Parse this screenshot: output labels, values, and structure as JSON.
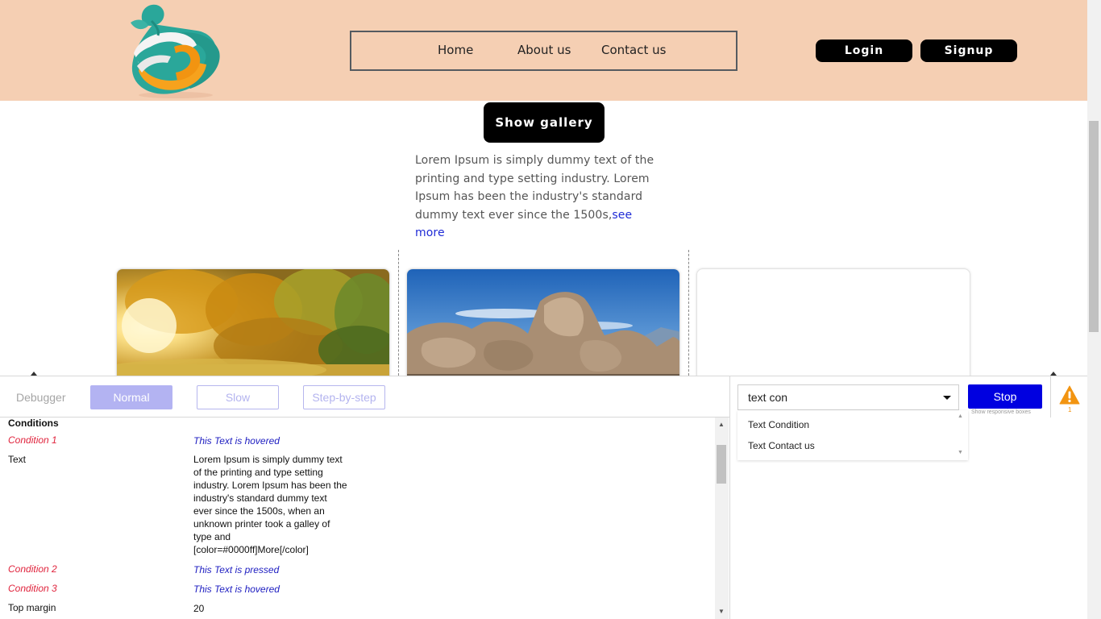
{
  "header": {
    "nav": {
      "home": "Home",
      "about": "About us",
      "contact": "Contact us"
    },
    "login": "Login",
    "signup": "Signup"
  },
  "main": {
    "gallery_button": "Show gallery",
    "intro_text": "Lorem Ipsum is simply dummy text of the printing and type setting industry. Lorem Ipsum has been the industry's standard dummy text ever since the 1500s,",
    "see_more": "see more"
  },
  "debugger": {
    "title": "Debugger",
    "modes": {
      "normal": "Normal",
      "slow": "Slow",
      "step": "Step-by-step"
    },
    "conditions_header": "Conditions",
    "rows": [
      {
        "label": "Condition 1",
        "value": "This Text is hovered"
      },
      {
        "label": "Text",
        "value": "Lorem Ipsum is simply dummy text of the printing and type setting industry. Lorem Ipsum has been the industry's standard dummy text ever since the 1500s, when an unknown printer took a galley of type and [color=#0000ff]More[/color]"
      },
      {
        "label": "Condition 2",
        "value": "This Text is pressed"
      },
      {
        "label": "Condition 3",
        "value": "This Text is hovered"
      },
      {
        "label": "Top margin",
        "value": "20"
      }
    ]
  },
  "tools": {
    "search_value": "text con",
    "suggestions": [
      "Text Condition",
      "Text Contact us"
    ],
    "stop": "Stop",
    "stop_caption": "Show responsive boxes",
    "warning_count": "1"
  },
  "colors": {
    "header_bg": "#f5cfb3",
    "accent_blue": "#0000e0",
    "warning": "#f29411",
    "condition_label": "#e0243d"
  }
}
